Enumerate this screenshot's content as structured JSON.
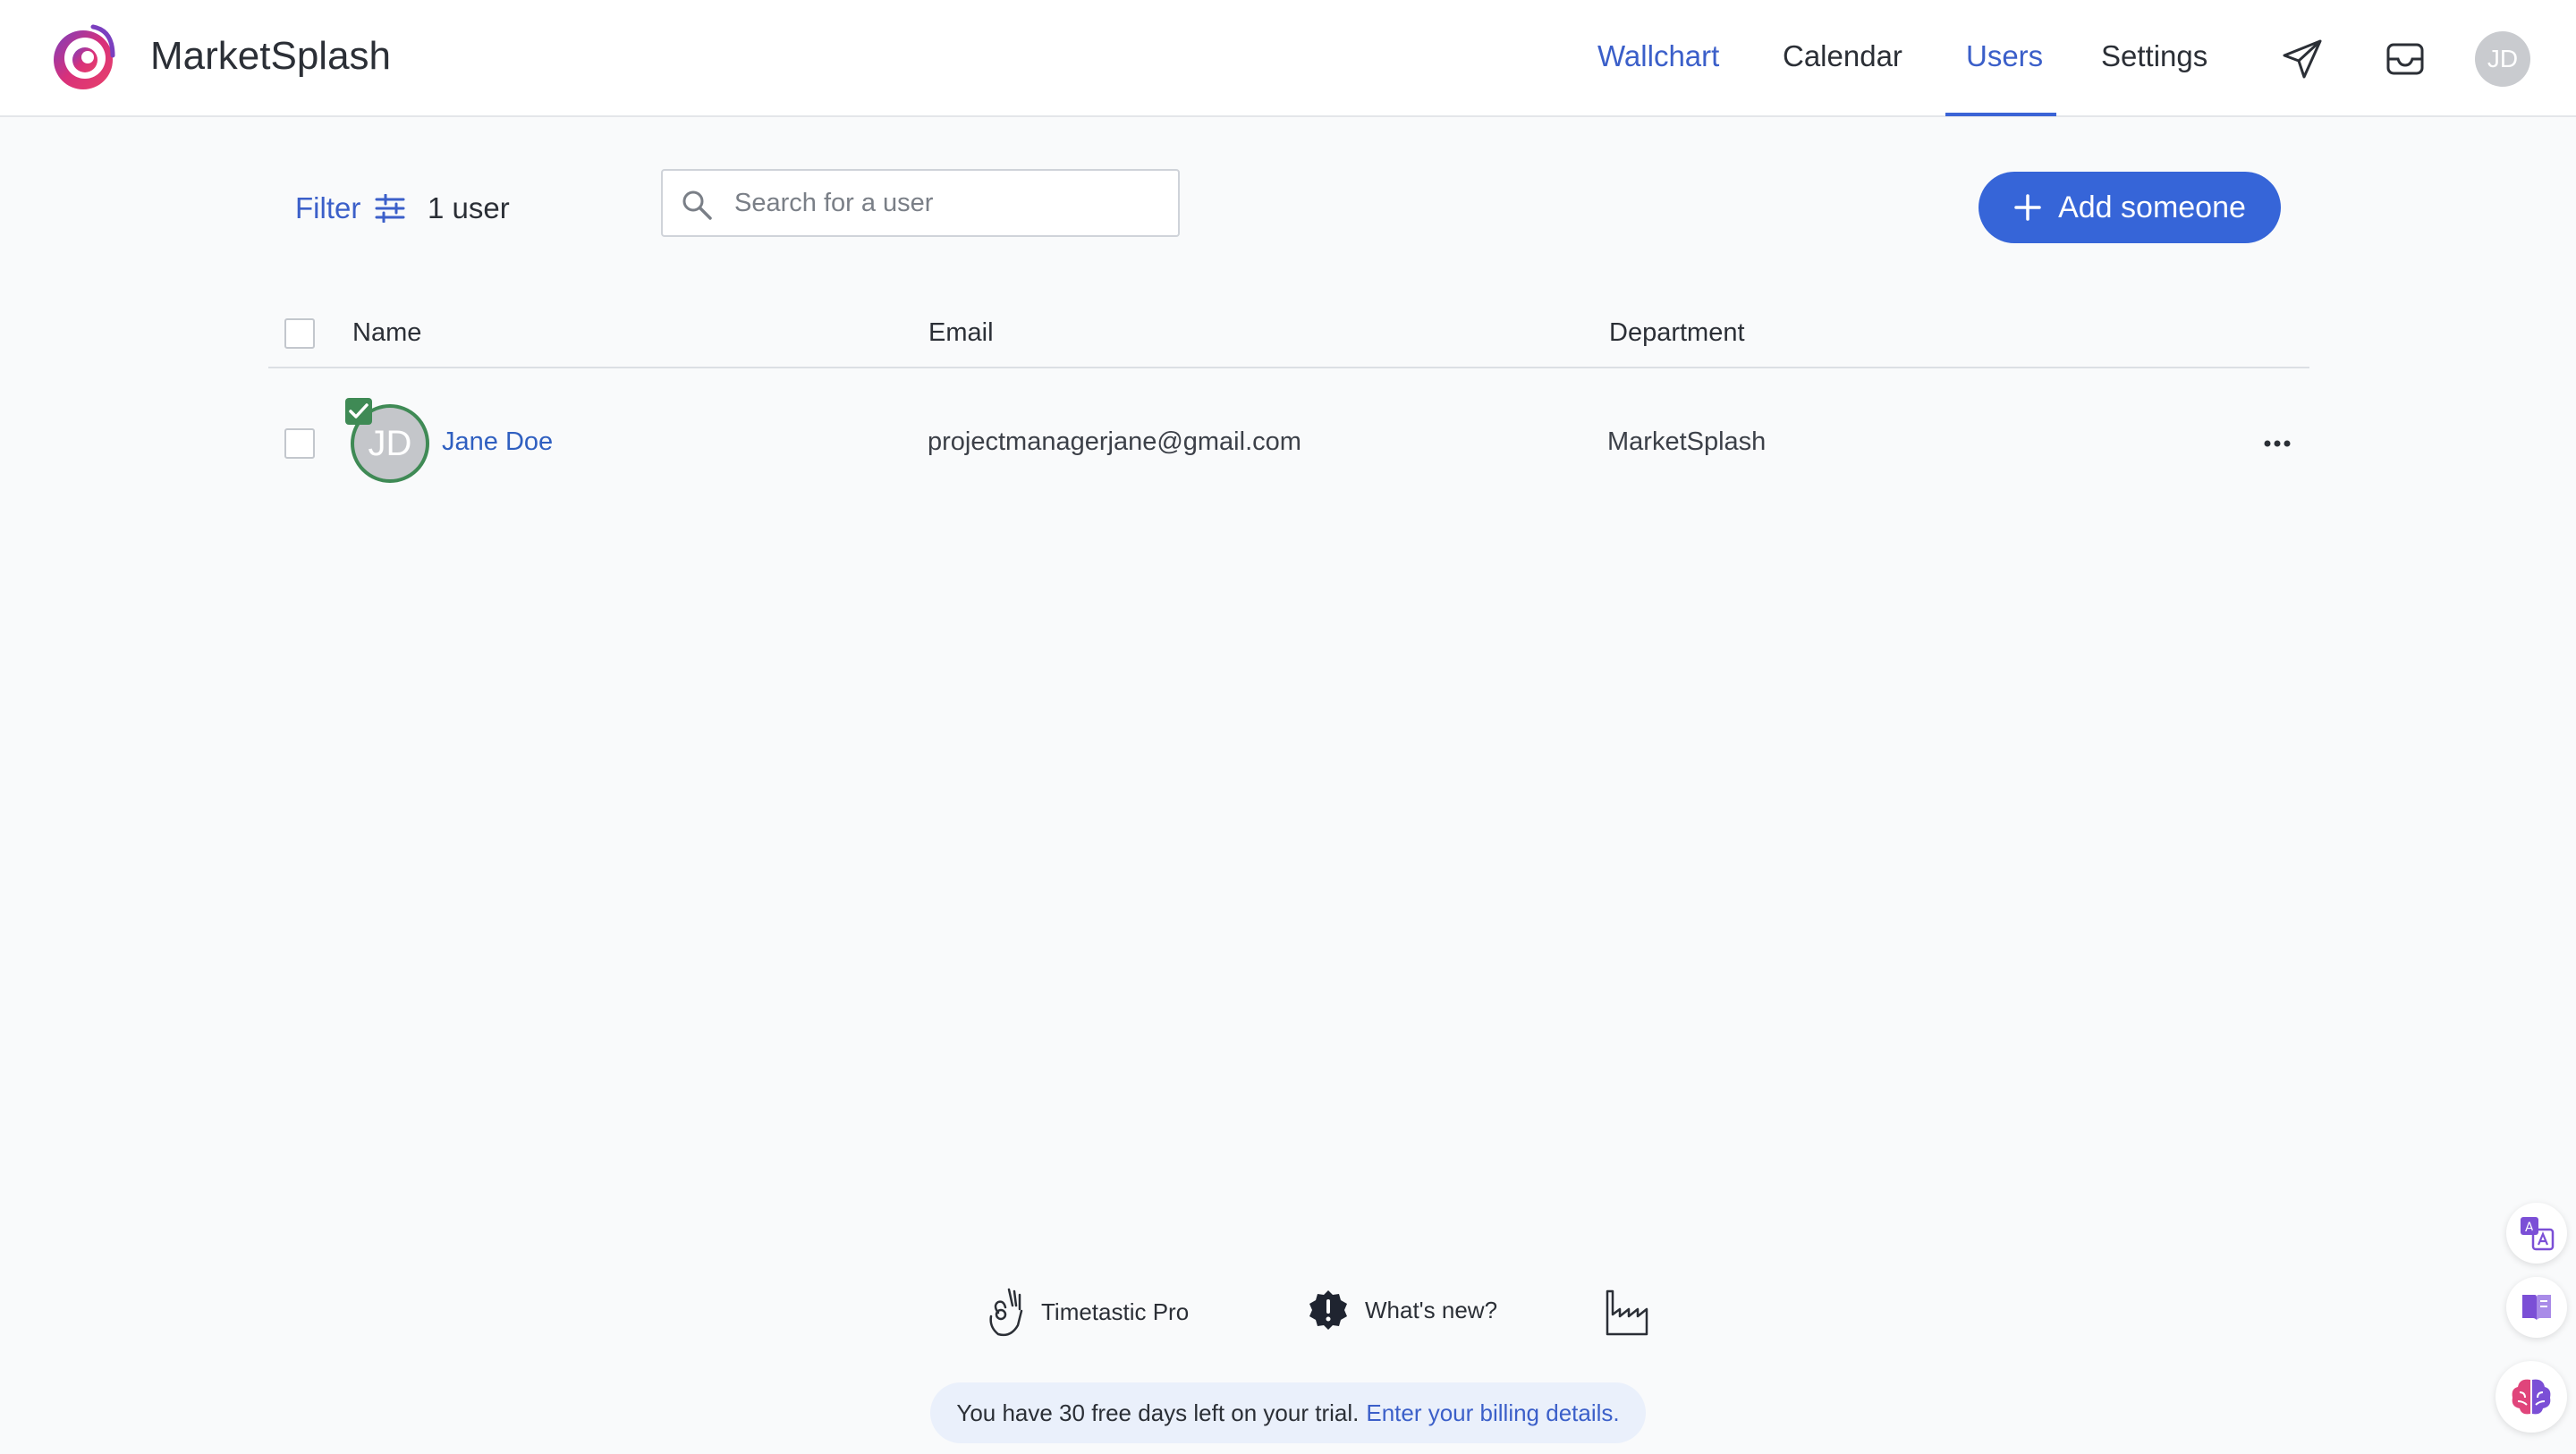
{
  "header": {
    "app_name": "MarketSplash",
    "nav": [
      {
        "label": "Wallchart",
        "active": false
      },
      {
        "label": "Calendar",
        "active": false
      },
      {
        "label": "Users",
        "active": true
      },
      {
        "label": "Settings",
        "active": false
      }
    ],
    "icons": [
      "paper-plane-icon",
      "inbox-icon"
    ],
    "avatar_initials": "JD"
  },
  "toolbar": {
    "filter_label": "Filter",
    "user_count": "1 user",
    "search_placeholder": "Search for a user",
    "add_label": "Add someone"
  },
  "table": {
    "columns": [
      "Name",
      "Email",
      "Department"
    ],
    "rows": [
      {
        "initials": "JD",
        "name": "Jane Doe",
        "email": "projectmanagerjane@gmail.com",
        "department": "MarketSplash"
      }
    ]
  },
  "footer": {
    "links": [
      "Timetastic Pro",
      "What's new?"
    ],
    "trial_text": "You have 30 free days left on your trial.",
    "trial_link": "Enter your billing details."
  },
  "colors": {
    "accent": "#3665d8",
    "link": "#3b5fc9",
    "avatar_ring": "#3f8a55"
  }
}
